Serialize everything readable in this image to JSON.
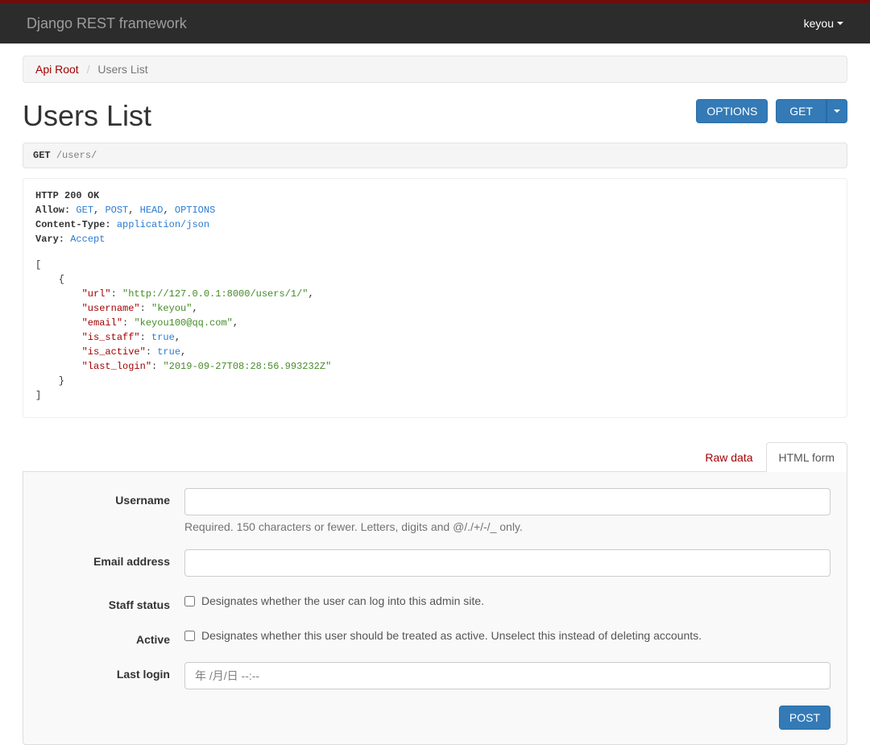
{
  "colors": {
    "accent": "#A30000",
    "primary": "#337ab7"
  },
  "navbar": {
    "brand": "Django REST framework",
    "user": "keyou"
  },
  "breadcrumb": {
    "root": "Api Root",
    "current": "Users List"
  },
  "page_title": "Users List",
  "buttons": {
    "options": "OPTIONS",
    "get": "GET",
    "post": "POST"
  },
  "request": {
    "method": "GET",
    "path": "/users/"
  },
  "response": {
    "status_line": "HTTP 200 OK",
    "headers": {
      "allow_label": "Allow:",
      "allow_methods": [
        "GET",
        "POST",
        "HEAD",
        "OPTIONS"
      ],
      "content_type_label": "Content-Type:",
      "content_type_value": "application/json",
      "vary_label": "Vary:",
      "vary_value": "Accept"
    },
    "body": [
      {
        "url": "http://127.0.0.1:8000/users/1/",
        "username": "keyou",
        "email": "keyou100@qq.com",
        "is_staff": "true",
        "is_active": "true",
        "last_login": "2019-09-27T08:28:56.993232Z"
      }
    ]
  },
  "tabs": {
    "raw_data": "Raw data",
    "html_form": "HTML form"
  },
  "form": {
    "username": {
      "label": "Username",
      "value": "",
      "help": "Required. 150 characters or fewer. Letters, digits and @/./+/-/_ only."
    },
    "email": {
      "label": "Email address",
      "value": ""
    },
    "staff": {
      "label": "Staff status",
      "help": "Designates whether the user can log into this admin site."
    },
    "active": {
      "label": "Active",
      "help": "Designates whether this user should be treated as active. Unselect this instead of deleting accounts."
    },
    "last_login": {
      "label": "Last login",
      "placeholder": "年 /月/日 --:--"
    }
  }
}
